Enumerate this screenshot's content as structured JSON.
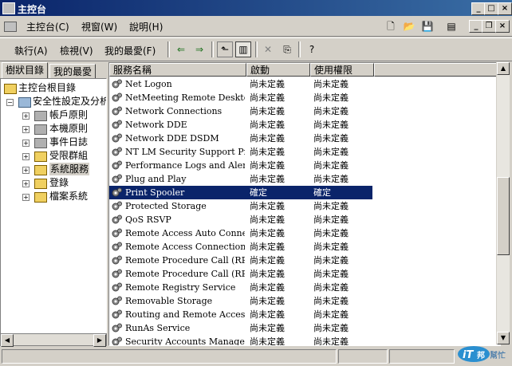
{
  "window": {
    "title": "主控台"
  },
  "menubar": {
    "items": [
      "主控台(C)",
      "視窗(W)",
      "說明(H)"
    ]
  },
  "toolbar": {
    "items": [
      "執行(A)",
      "檢視(V)",
      "我的最愛(F)"
    ]
  },
  "left_pane": {
    "tabs": [
      "樹狀目錄",
      "我的最愛"
    ],
    "tree": {
      "root": "主控台根目錄",
      "child": "安全性設定及分析",
      "items": [
        "帳戶原則",
        "本機原則",
        "事件日誌",
        "受限群組",
        "系統服務",
        "登錄",
        "檔案系統"
      ]
    }
  },
  "list": {
    "columns": [
      "服務名稱",
      "啟動",
      "使用權限"
    ],
    "rows": [
      {
        "name": "Net Logon",
        "startup": "尚未定義",
        "perm": "尚未定義"
      },
      {
        "name": "NetMeeting Remote Desktop ...",
        "startup": "尚未定義",
        "perm": "尚未定義"
      },
      {
        "name": "Network Connections",
        "startup": "尚未定義",
        "perm": "尚未定義"
      },
      {
        "name": "Network DDE",
        "startup": "尚未定義",
        "perm": "尚未定義"
      },
      {
        "name": "Network DDE DSDM",
        "startup": "尚未定義",
        "perm": "尚未定義"
      },
      {
        "name": "NT LM Security Support Pro...",
        "startup": "尚未定義",
        "perm": "尚未定義"
      },
      {
        "name": "Performance Logs and Alerts",
        "startup": "尚未定義",
        "perm": "尚未定義"
      },
      {
        "name": "Plug and Play",
        "startup": "尚未定義",
        "perm": "尚未定義"
      },
      {
        "name": "Print Spooler",
        "startup": "確定",
        "perm": "確定"
      },
      {
        "name": "Protected Storage",
        "startup": "尚未定義",
        "perm": "尚未定義"
      },
      {
        "name": "QoS RSVP",
        "startup": "尚未定義",
        "perm": "尚未定義"
      },
      {
        "name": "Remote Access Auto Connect...",
        "startup": "尚未定義",
        "perm": "尚未定義"
      },
      {
        "name": "Remote Access Connection ...",
        "startup": "尚未定義",
        "perm": "尚未定義"
      },
      {
        "name": "Remote Procedure Call (RPC)",
        "startup": "尚未定義",
        "perm": "尚未定義"
      },
      {
        "name": "Remote Procedure Call (RPC...",
        "startup": "尚未定義",
        "perm": "尚未定義"
      },
      {
        "name": "Remote Registry Service",
        "startup": "尚未定義",
        "perm": "尚未定義"
      },
      {
        "name": "Removable Storage",
        "startup": "尚未定義",
        "perm": "尚未定義"
      },
      {
        "name": "Routing and Remote Access",
        "startup": "尚未定義",
        "perm": "尚未定義"
      },
      {
        "name": "RunAs Service",
        "startup": "尚未定義",
        "perm": "尚未定義"
      },
      {
        "name": "Security Accounts Manager",
        "startup": "尚未定義",
        "perm": "尚未定義"
      }
    ],
    "selected_index": 8
  },
  "logo": {
    "text": "iT邦幫忙"
  },
  "colors": {
    "titlebar": "#0a246a",
    "selection": "#0a246a",
    "face": "#d4d0c8"
  }
}
